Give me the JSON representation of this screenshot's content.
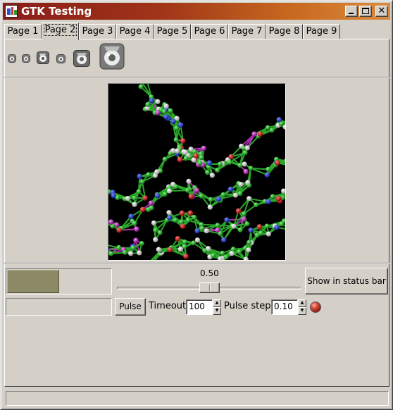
{
  "window": {
    "title": "GTK Testing",
    "minimize_label": "_",
    "maximize_label": "□",
    "close_label": "✕"
  },
  "tabs": [
    {
      "label": "Page 1"
    },
    {
      "label": "Page 2",
      "active": true
    },
    {
      "label": "Page 3"
    },
    {
      "label": "Page 4"
    },
    {
      "label": "Page 5"
    },
    {
      "label": "Page 6"
    },
    {
      "label": "Page 7"
    },
    {
      "label": "Page 8"
    },
    {
      "label": "Page 9"
    }
  ],
  "toolbar": {
    "icons": [
      "gimp-icon",
      "gimp-icon",
      "gimp-icon",
      "gimp-icon",
      "gimp-icon",
      "gimp-icon"
    ]
  },
  "image": {
    "description_icon": "molecule-image"
  },
  "progress": {
    "fraction": 0.5
  },
  "slider": {
    "value_label": "0.50",
    "value": 0.5
  },
  "buttons": {
    "show_in_status_bar": "Show in status bar",
    "pulse": "Pulse"
  },
  "timeout": {
    "label": "Timeout",
    "value": "100"
  },
  "pulse_step": {
    "label": "Pulse step",
    "value": "0.10"
  },
  "status_bar": {
    "text": ""
  },
  "colors": {
    "title_gradient_start": "#8a1d1a",
    "title_gradient_end": "#d98c40",
    "progress_fill": "#8c8a66",
    "led": "#d44a3a"
  }
}
